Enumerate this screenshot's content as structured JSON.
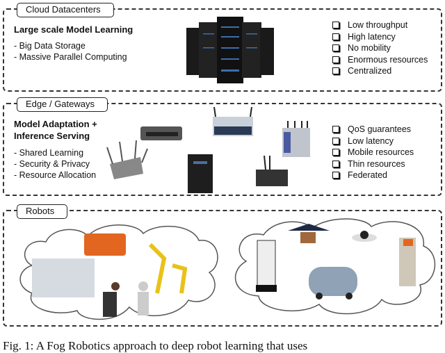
{
  "cloud": {
    "tab": "Cloud Datacenters",
    "heading": "Large scale Model Learning",
    "bullets": [
      "- Big Data Storage",
      "- Massive Parallel Computing"
    ],
    "properties": [
      "Low throughput",
      "High latency",
      "No mobility",
      "Enormous resources",
      "Centralized"
    ],
    "image": "server-racks"
  },
  "edge": {
    "tab": "Edge / Gateways",
    "heading_line1": "Model Adaptation +",
    "heading_line2": "Inference Serving",
    "bullets": [
      "- Shared Learning",
      "- Security & Privacy",
      "- Resource Allocation"
    ],
    "properties": [
      "QoS guarantees",
      "Low latency",
      "Mobile resources",
      "Thin resources",
      "Federated"
    ],
    "devices": [
      "wireless-access-point",
      "network-switch",
      "iot-gateway",
      "tower-server",
      "embedded-pc",
      "industrial-router"
    ]
  },
  "robots": {
    "tab": "Robots",
    "left_cloud": [
      "surgical-robot",
      "warehouse-robot",
      "industrial-arms",
      "humanoid-robot"
    ],
    "right_cloud": [
      "service-robot",
      "delivery-drone",
      "security-camera",
      "self-driving-car",
      "pr2-robot"
    ]
  },
  "caption": "Fig. 1: A Fog Robotics approach to deep robot learning that uses"
}
